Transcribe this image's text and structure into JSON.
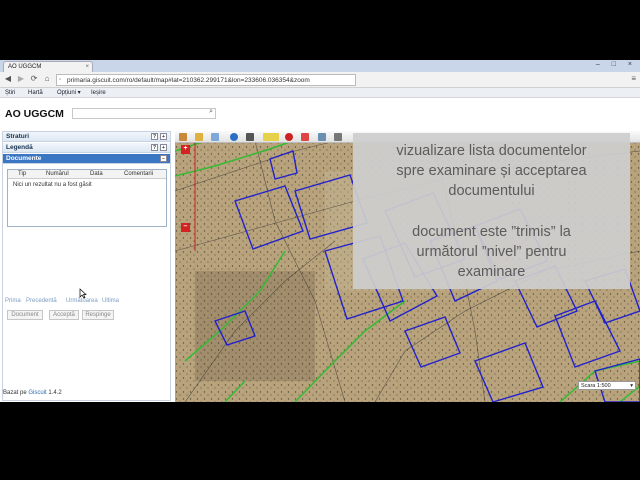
{
  "browser": {
    "tab_title": "AO UGGCM",
    "tab_close": "×",
    "window_controls": "– □ ×",
    "url": "primaria.giscuit.com/ro/default/map#lat=210362.299171&lon=233606.036354&zoom"
  },
  "app_menu": {
    "items": [
      "Știri",
      "Hartă",
      "Opțiuni ▾",
      "Ieșire"
    ]
  },
  "header": {
    "title": "AO UGGCM"
  },
  "panel": {
    "sections": [
      "Straturi",
      "Legendă",
      "Documente"
    ],
    "section_buttons": [
      "?",
      "?"
    ],
    "collapse": "–",
    "columns": [
      "Tip",
      "Numărul",
      "Data",
      "Comentarii"
    ],
    "empty_text": "Nici un rezultat nu a fost găsit",
    "pager": [
      "Prima",
      "Precedentă",
      "Următoarea",
      "Ultima"
    ],
    "actions": [
      "Document",
      "Acceptă",
      "Respinge"
    ],
    "footer_prefix": "Bazat pe",
    "footer_link": "Giscuit",
    "footer_version": "1.4.2"
  },
  "map": {
    "zoom_in": "+",
    "zoom_out": "–",
    "scale_label": "Scara",
    "scale_value": "1:500"
  },
  "overlay": {
    "line1": "vizualizare lista documentelor",
    "line2": "spre examinare și acceptarea",
    "line3": "documentului",
    "line4": "document este ”trimis” la",
    "line5": "următorul ”nivel” pentru",
    "line6": "examinare"
  },
  "colors": {
    "panel_active": "#3a76c1",
    "parcel_outline": "#2222cc",
    "road_outline": "#33bb33",
    "accent_red": "#d32222",
    "link": "#2d6bb3"
  },
  "icons": [
    "back-icon",
    "forward-icon",
    "reload-icon",
    "home-icon",
    "menu-icon",
    "search-icon",
    "mouse-cursor"
  ]
}
